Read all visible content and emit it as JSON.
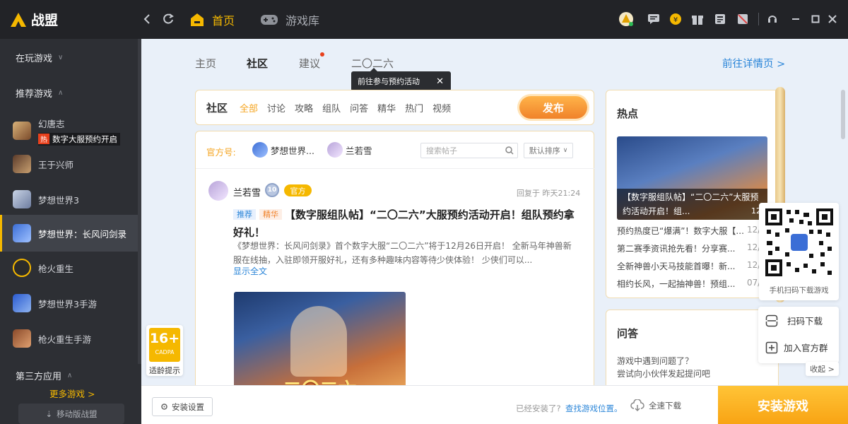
{
  "app": {
    "name": "战盟"
  },
  "titlebar": {
    "home_label": "首页",
    "library_label": "游戏库"
  },
  "sidebar": {
    "playing_label": "在玩游戏",
    "recommended_label": "推荐游戏",
    "games": [
      {
        "name": "幻唐志",
        "badge_icon": "热",
        "badge": "数字大服预约开启"
      },
      {
        "name": "王于兴师"
      },
      {
        "name": "梦想世界3"
      },
      {
        "name": "梦想世界：长风问剑录"
      },
      {
        "name": "枪火重生"
      },
      {
        "name": "梦想世界3手游"
      },
      {
        "name": "枪火重生手游"
      }
    ],
    "third_party_label": "第三方应用",
    "more_games": "更多游戏 >",
    "mobile_label": "移动版战盟"
  },
  "main": {
    "tabs": [
      "主页",
      "社区",
      "建议",
      "二〇二六"
    ],
    "detail_link": "前往详情页 >",
    "tooltip": "前往参与预约活动",
    "community": {
      "title": "社区",
      "filters": [
        "全部",
        "讨论",
        "攻略",
        "组队",
        "问答",
        "精华",
        "热门",
        "视频"
      ],
      "publish": "发布",
      "official_label": "官方号:",
      "official_accounts": [
        "梦想世界...",
        "兰若雪"
      ],
      "search_placeholder": "搜索帖子",
      "sort_label": "默认排序"
    },
    "post": {
      "author": "兰若雪",
      "level": "10",
      "official_tag": "官方",
      "reply_time": "回复于 昨天21:24",
      "tag_recommend": "推荐",
      "tag_essence": "精华",
      "title": "【数字服组队帖】“二〇二六”大服预约活动开启！组队预约拿好礼！",
      "body": "《梦想世界：长风问剑录》首个数字大服“二〇二六”将于12月26日开启！ 全新马年神兽新服在线抽，入驻即领开服好礼，还有多种趣味内容等待少侠体验！ 少侠们可以...",
      "expand": "显示全文",
      "image_text": "二〇二六"
    },
    "hot": {
      "title": "热点",
      "banner_caption": "【数字服组队帖】“二〇二六”大服预约活动开启！组...",
      "banner_date": "12/",
      "items": [
        {
          "text": "预约热度已“爆满”！数字大服【...",
          "date": "12/"
        },
        {
          "text": "第二赛季资讯抢先看！分享赛...",
          "date": "12/"
        },
        {
          "text": "全新神兽小天马技能首曝！新...",
          "date": "12/"
        },
        {
          "text": "相约长风，一起抽神兽！预组...",
          "date": "07/"
        }
      ]
    },
    "qa": {
      "title": "问答",
      "line1": "游戏中遇到问题了？",
      "line2": "尝试向小伙伴发起提问吧"
    },
    "qr": {
      "caption": "手机扫码下载游戏",
      "scan_download": "扫码下载",
      "join_group": "加入官方群",
      "collapse": "收起 >"
    },
    "age": {
      "rating": "16+",
      "cadpa": "CADPA",
      "hint": "适龄提示"
    }
  },
  "bottom": {
    "install_settings": "安装设置",
    "installed_q": "已经安装了?",
    "find_location": "查找游戏位置。",
    "full_download": "全速下载",
    "install_game": "安装游戏"
  },
  "colors": {
    "accent": "#f5b800",
    "link": "#2a85d8",
    "install": "#fbb31a"
  }
}
